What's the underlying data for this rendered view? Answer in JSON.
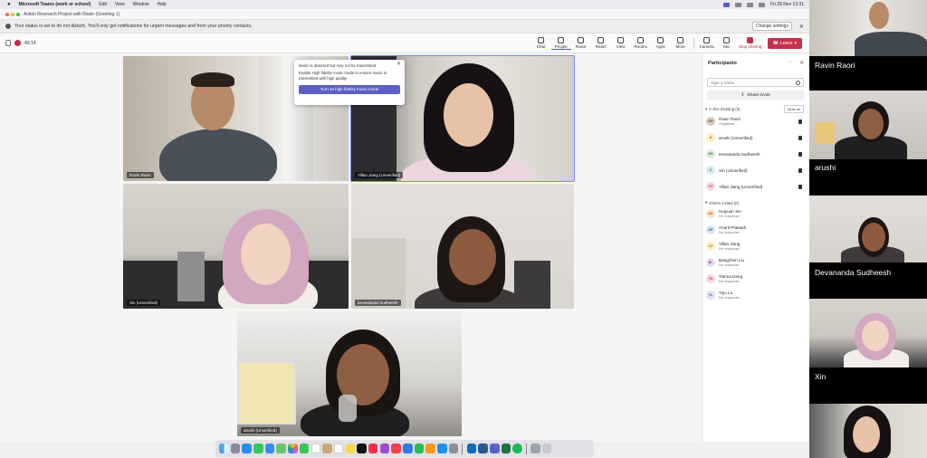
{
  "menubar": {
    "app": "Microsoft Teams (work or school)",
    "items": [
      "Edit",
      "View",
      "Window",
      "Help"
    ],
    "clock": "Fri 29 Nov 13:31"
  },
  "titlebar": {
    "title": "Action Research Project with Ravin (Greeting 1)"
  },
  "banner": {
    "text": "Your status is set to do not disturb. You'll only get notifications for urgent messages and from your priority contacts.",
    "button": "Change settings"
  },
  "toolbar": {
    "timer": "40:14",
    "tools": [
      "Chat",
      "People",
      "Raise",
      "React",
      "View",
      "Rooms",
      "Apps",
      "More"
    ],
    "av_tools": [
      "Camera",
      "Mic",
      "Stop sharing"
    ],
    "leave": "Leave"
  },
  "popup": {
    "title": "Music is detected but may not be transmitted",
    "body": "Enable High fidelity music mode to ensure music is transmitted with high quality",
    "button": "Turn on high fidelity music mode"
  },
  "tiles": [
    {
      "label": "Ravin Raori"
    },
    {
      "label": "Yillan Jiang (Unverified)"
    },
    {
      "label": "Xin (Unverified)"
    },
    {
      "label": "Devananda Sudheesh"
    },
    {
      "label": "arushi (Unverified)"
    }
  ],
  "panel": {
    "title": "Participants",
    "search_placeholder": "Type a name",
    "share": "Share invite",
    "in_meeting": "In this meeting (5)",
    "mute_all": "Mute all",
    "members": [
      {
        "name": "Ravin Raori",
        "sub": "Organiser",
        "initials": "RR",
        "color": "#7a5c4a",
        "bg": "#d9cbbf"
      },
      {
        "name": "arushi (Unverified)",
        "sub": "",
        "initials": "A",
        "color": "#8a6a00",
        "bg": "#fbeec2"
      },
      {
        "name": "Devananda Sudheesh",
        "sub": "",
        "initials": "DS",
        "color": "#2e6b2e",
        "bg": "#dcefd8"
      },
      {
        "name": "Xin (Unverified)",
        "sub": "",
        "initials": "X",
        "color": "#2f6e6e",
        "bg": "#d6efec"
      },
      {
        "name": "Yillan Jiang (Unverified)",
        "sub": "",
        "initials": "YJ",
        "color": "#8c2f48",
        "bg": "#f5d7df"
      }
    ],
    "others": "Others invited (6)",
    "invited": [
      {
        "name": "Huiyuan Xin",
        "sub": "No response",
        "initials": "HX",
        "color": "#a2591a",
        "bg": "#fbe3cc"
      },
      {
        "name": "Anurit Prakash",
        "sub": "No response",
        "initials": "AP",
        "color": "#2a5d8f",
        "bg": "#d6e5f5"
      },
      {
        "name": "Yillan Jiang",
        "sub": "No response",
        "initials": "YJ",
        "color": "#8a6a00",
        "bg": "#fbeec2"
      },
      {
        "name": "Bangzhen Liu",
        "sub": "No response",
        "initials": "BL",
        "color": "#7a3d8c",
        "bg": "#ead9f0"
      },
      {
        "name": "Tianna Deng",
        "sub": "No response",
        "initials": "TD",
        "color": "#a83a5e",
        "bg": "#f7d6e1"
      },
      {
        "name": "Yiyu Lu",
        "sub": "No response",
        "initials": "YL",
        "color": "#4a5a9a",
        "bg": "#dde2f3"
      }
    ]
  },
  "gallery": [
    {
      "name": "Ravin Raori"
    },
    {
      "name": "arushi"
    },
    {
      "name": "Devananda Sudheesh"
    },
    {
      "name": "Xin"
    },
    {
      "name": ""
    }
  ]
}
